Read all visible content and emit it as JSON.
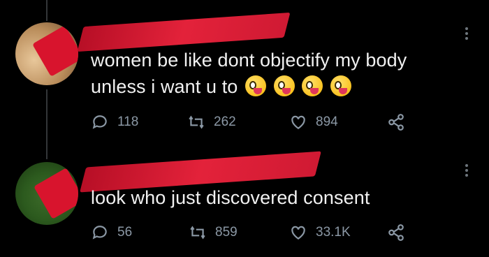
{
  "tweets": [
    {
      "text_line1": "women be like dont objectify my body",
      "text_line2": "unless i want u to",
      "emojis": [
        "zany-face",
        "zany-face",
        "zany-face",
        "zany-face"
      ],
      "replies": "118",
      "retweets": "262",
      "likes": "894"
    },
    {
      "text_line1": "look who just discovered consent",
      "replies": "56",
      "retweets": "859",
      "likes": "33.1K"
    }
  ],
  "colors": {
    "background": "#000000",
    "text": "#e7e9ea",
    "muted": "#8b98a5",
    "redaction": "#d8142d"
  },
  "icons": [
    "reply-icon",
    "retweet-icon",
    "like-icon",
    "share-icon",
    "more-options-icon"
  ]
}
